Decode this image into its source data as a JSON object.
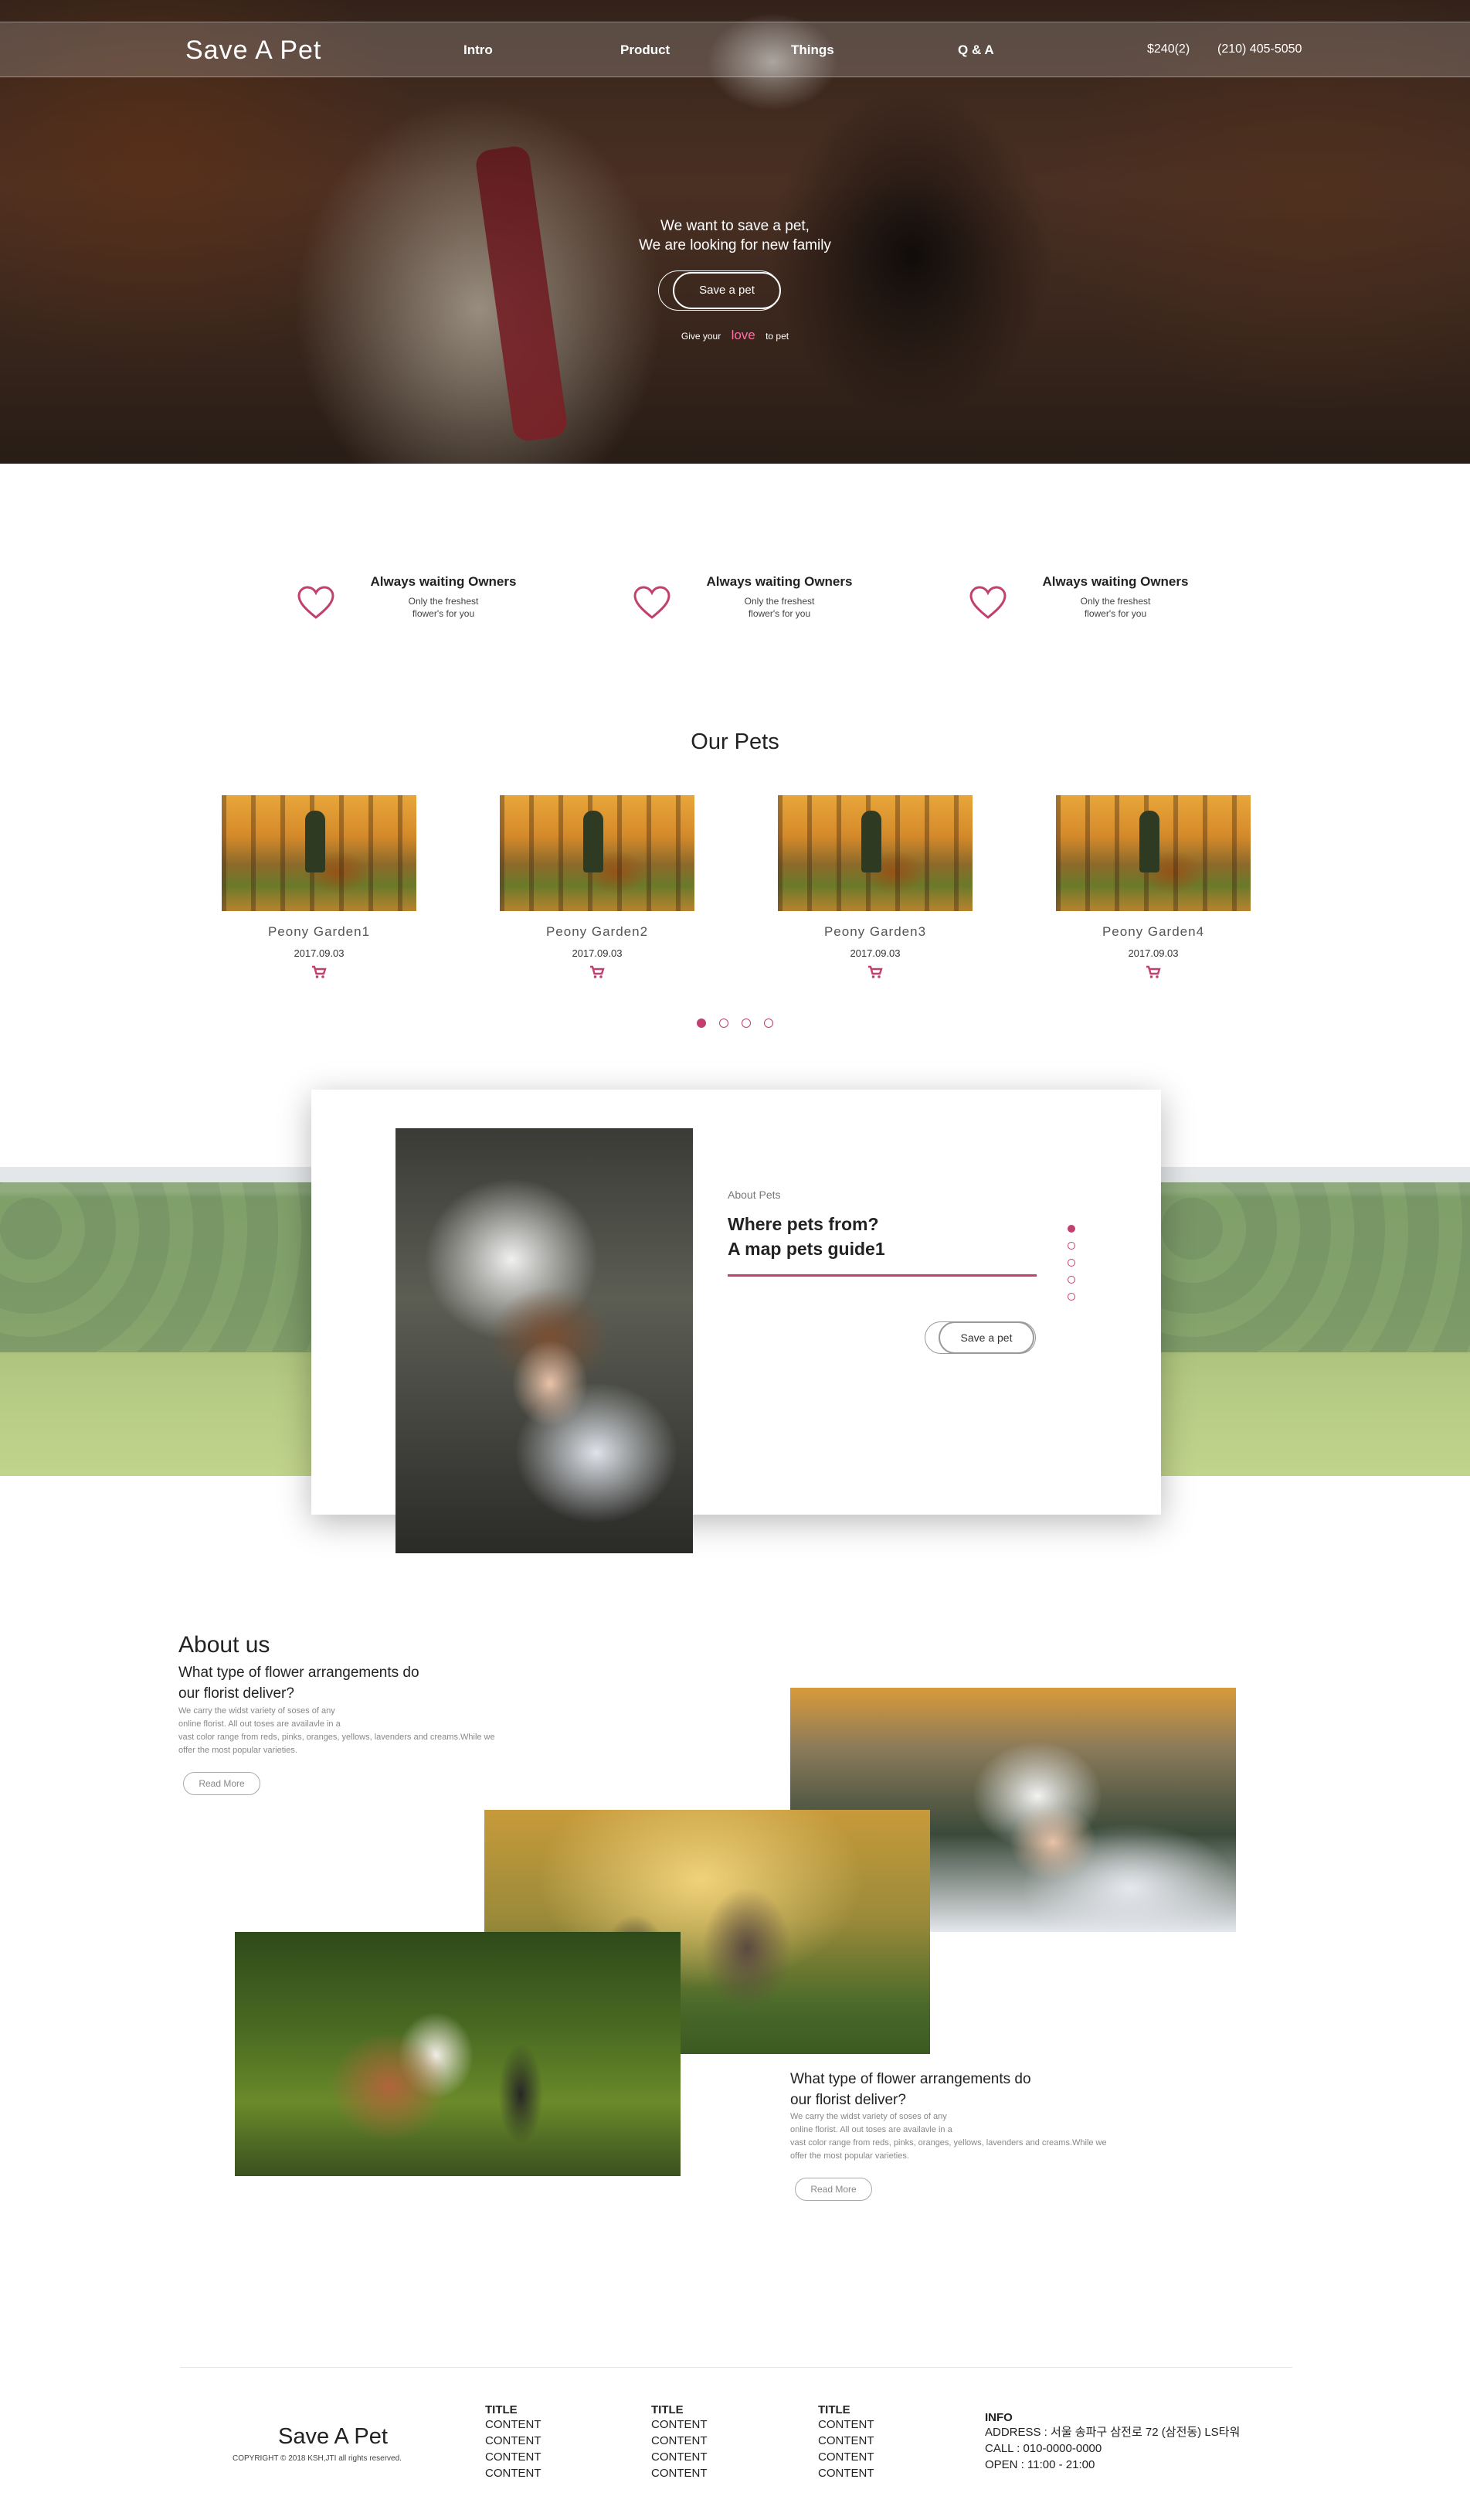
{
  "brand": "Save A Pet",
  "nav": {
    "items": [
      "Intro",
      "Product",
      "Things",
      "Q & A"
    ],
    "cart": "$240(2)",
    "phone": "(210) 405-5050"
  },
  "hero": {
    "line1": "We want to save a pet,",
    "line2": "We are looking for new family",
    "button": "Save a pet",
    "sub_before": "Give your",
    "sub_love": "love",
    "sub_after": "to pet"
  },
  "features": [
    {
      "title": "Always waiting Owners",
      "desc1": "Only the freshest",
      "desc2": "flower's for you",
      "icon": "heart-icon"
    },
    {
      "title": "Always waiting Owners",
      "desc1": "Only the freshest",
      "desc2": "flower's for you",
      "icon": "heart-icon"
    },
    {
      "title": "Always waiting Owners",
      "desc1": "Only the freshest",
      "desc2": "flower's for you",
      "icon": "heart-icon"
    }
  ],
  "pets": {
    "title": "Our Pets",
    "cards": [
      {
        "name": "Peony Garden1",
        "date": "2017.09.03",
        "icon": "cart-icon"
      },
      {
        "name": "Peony Garden2",
        "date": "2017.09.03",
        "icon": "cart-icon"
      },
      {
        "name": "Peony Garden3",
        "date": "2017.09.03",
        "icon": "cart-icon"
      },
      {
        "name": "Peony Garden4",
        "date": "2017.09.03",
        "icon": "cart-icon"
      }
    ],
    "active_slide": 1,
    "slide_count": 4
  },
  "about_pets": {
    "label": "About Pets",
    "title1": "Where pets from?",
    "title2": "A map pets guide1",
    "button": "Save a pet",
    "active_dot": 1,
    "dot_count": 5
  },
  "about_us": {
    "heading": "About us",
    "block1": {
      "sub1": "What type of flower arrangements do",
      "sub2": "our florist deliver?",
      "body1": "We carry the widst variety of soses of any",
      "body2": "online florist. All out toses are availavle in a",
      "body3": "vast color range from reds, pinks, oranges, yellows, lavenders and creams.While we",
      "body4": "offer the most popular varieties.",
      "button": "Read More"
    },
    "block2": {
      "sub1": "What type of flower arrangements do",
      "sub2": "our florist deliver?",
      "body1": "We carry the widst variety of soses of any",
      "body2": "online florist. All out toses are availavle in a",
      "body3": "vast color range from reds, pinks, oranges, yellows, lavenders and creams.While we",
      "body4": "offer the most popular varieties.",
      "button": "Read More"
    }
  },
  "footer": {
    "logo": "Save A Pet",
    "copyright": "COPYRIGHT © 2018 KSH,JTI all rights reserved.",
    "columns": [
      {
        "title": "TITLE",
        "items": [
          "CONTENT",
          "CONTENT",
          "CONTENT",
          "CONTENT"
        ]
      },
      {
        "title": "TITLE",
        "items": [
          "CONTENT",
          "CONTENT",
          "CONTENT",
          "CONTENT"
        ]
      },
      {
        "title": "TITLE",
        "items": [
          "CONTENT",
          "CONTENT",
          "CONTENT",
          "CONTENT"
        ]
      }
    ],
    "info": {
      "title": "INFO",
      "address": "ADDRESS : 서울 송파구 삼전로 72 (삼전동) LS타워",
      "call": "CALL : 010-0000-0000",
      "open": "OPEN : 11:00 - 21:00"
    }
  },
  "colors": {
    "accent": "#c2406f",
    "text": "#222222",
    "muted": "#888888"
  }
}
